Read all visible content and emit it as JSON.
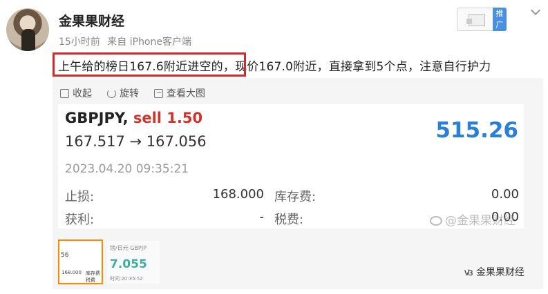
{
  "post": {
    "username": "金果果财经",
    "time": "15小时前",
    "source": "来自 iPhone客户端",
    "promo_badge": "推广",
    "text": "上午给的榜日167.6附近进空的，现价167.0附近，直接拿到5个点，注意自行护力"
  },
  "actions": {
    "collapse": "收起",
    "rotate": "旋转",
    "view_large": "查看大图"
  },
  "trade": {
    "symbol": "GBPJPY,",
    "side": "sell 1.50",
    "price_move": "167.517 → 167.056",
    "profit": "515.26",
    "datetime": "2023.04.20 09:35:21",
    "stop_loss_label": "止损:",
    "stop_loss_value": "168.000",
    "take_profit_label": "获利:",
    "take_profit_value": "-",
    "swap_label": "库存费:",
    "swap_value": "0.00",
    "tax_label": "税费:",
    "tax_value": "0.00"
  },
  "watermark": {
    "text": "@金果果财经"
  },
  "thumbnails": {
    "t1_a": "56",
    "t1_b": "168.000",
    "t1_c": "库存费",
    "t1_d": "税费",
    "t2_title": "镑/日元  GBPJP",
    "t2_value": "7.055",
    "t2_time": "时间:20:35:52"
  },
  "bottom_watermark": "金果果财经",
  "colors": {
    "highlight": "#d62a2a",
    "sell": "#d0352c",
    "profit": "#2a7fd6",
    "promo": "#4a90e2"
  }
}
